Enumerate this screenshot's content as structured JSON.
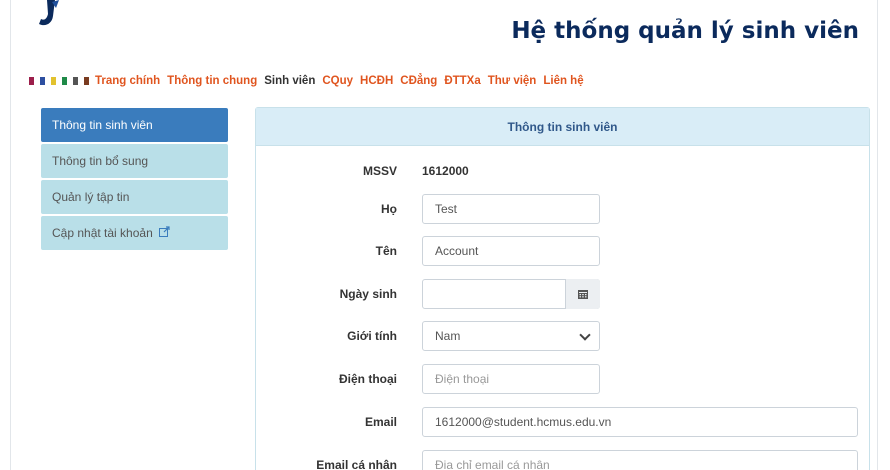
{
  "header": {
    "title": "Hệ thống quản lý sinh viên"
  },
  "nav": {
    "squares": [
      "#9c1f4b",
      "#2d4fa0",
      "#e2c22e",
      "#1f8a48",
      "#555555",
      "#7a3b20"
    ],
    "items": [
      {
        "label": "Trang chính",
        "style": "accent"
      },
      {
        "label": "Thông tin chung",
        "style": "accent"
      },
      {
        "label": "Sinh viên",
        "style": "plain"
      },
      {
        "label": "CQuy",
        "style": "accent"
      },
      {
        "label": "HCĐH",
        "style": "accent"
      },
      {
        "label": "CĐẳng",
        "style": "accent"
      },
      {
        "label": "ĐTTXa",
        "style": "accent"
      },
      {
        "label": "Thư viện",
        "style": "accent"
      },
      {
        "label": "Liên hệ",
        "style": "accent"
      }
    ]
  },
  "sidebar": {
    "items": [
      {
        "label": "Thông tin sinh viên",
        "active": true
      },
      {
        "label": "Thông tin bổ sung",
        "active": false
      },
      {
        "label": "Quản lý tập tin",
        "active": false
      },
      {
        "label": "Cập nhật tài khoản",
        "active": false,
        "icon": "external-link-icon"
      }
    ]
  },
  "panel": {
    "title": "Thông tin sinh viên",
    "fields": {
      "mssv": {
        "label": "MSSV",
        "value": "1612000"
      },
      "ho": {
        "label": "Họ",
        "value": "Test"
      },
      "ten": {
        "label": "Tên",
        "value": "Account"
      },
      "ngay_sinh": {
        "label": "Ngày sinh",
        "value": "",
        "icon": "calendar-icon"
      },
      "gioi_tinh": {
        "label": "Giới tính",
        "value": "Nam"
      },
      "dien_thoai": {
        "label": "Điện thoại",
        "value": "",
        "placeholder": "Điện thoại"
      },
      "email": {
        "label": "Email",
        "value": "1612000@student.hcmus.edu.vn"
      },
      "email_ca_nhan": {
        "label": "Email cá nhân",
        "value": "",
        "placeholder": "Địa chỉ email cá nhân"
      }
    }
  }
}
